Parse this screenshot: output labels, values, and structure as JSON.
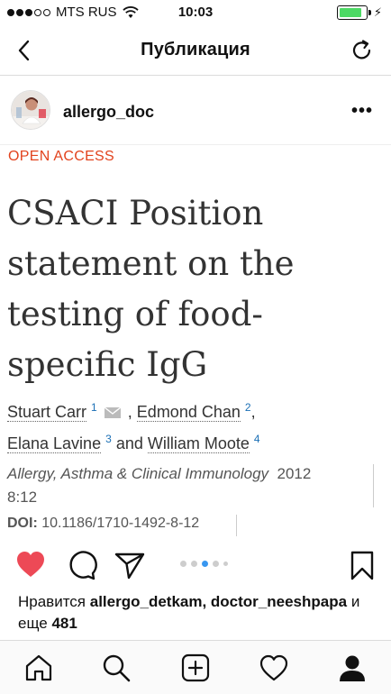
{
  "status_bar": {
    "carrier": "MTS RUS",
    "time": "10:03",
    "signal_dots_filled": 3,
    "signal_dots_total": 5,
    "battery_level": 0.85,
    "battery_color": "#4cd964"
  },
  "nav": {
    "title": "Публикация",
    "back_icon": "chevron-left-icon",
    "refresh_icon": "refresh-icon"
  },
  "post": {
    "username": "allergo_doc",
    "more_label": "•••"
  },
  "article": {
    "open_access": "OPEN ACCESS",
    "open_access_color": "#e2431e",
    "title": "CSACI Position statement on the testing of food-specific IgG",
    "authors": [
      {
        "name": "Stuart Carr",
        "sup": "1"
      },
      {
        "name": "Edmond Chan",
        "sup": "2"
      },
      {
        "name": "Elana Lavine",
        "sup": "3"
      },
      {
        "name": "William Moote",
        "sup": "4"
      }
    ],
    "separator_comma": ",",
    "separator_and": "and",
    "journal_name": "Allergy, Asthma & Clinical Immunology",
    "journal_year": "2012",
    "journal_volume": "8:12",
    "doi_label": "DOI:",
    "doi_value": "10.1186/1710-1492-8-12"
  },
  "carousel": {
    "count": 5,
    "active_index": 2,
    "active_color": "#3897f0"
  },
  "likes": {
    "prefix": "Нравится",
    "users": "allergo_detkam, doctor_neeshpapa",
    "connector": "и еще",
    "count": "481"
  },
  "colors": {
    "like_heart": "#ed4956"
  },
  "tabs": [
    "home-icon",
    "search-icon",
    "add-post-icon",
    "activity-icon",
    "profile-icon"
  ]
}
